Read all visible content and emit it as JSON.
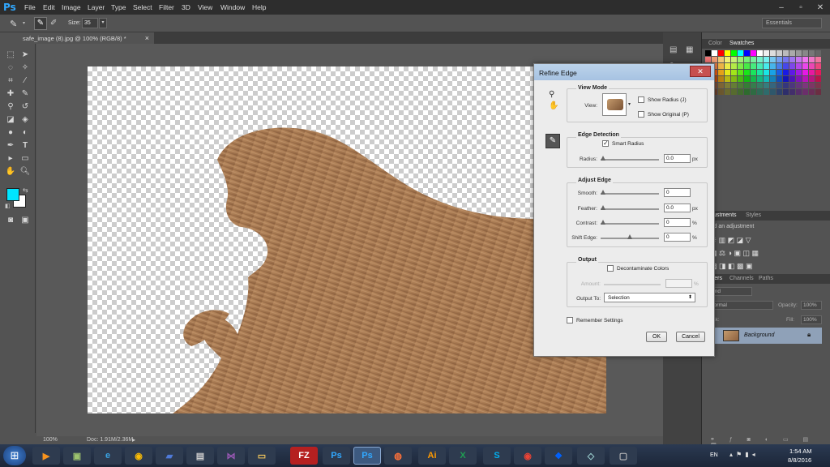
{
  "app": {
    "logo": "Ps"
  },
  "menu": [
    "File",
    "Edit",
    "Image",
    "Layer",
    "Type",
    "Select",
    "Filter",
    "3D",
    "View",
    "Window",
    "Help"
  ],
  "options": {
    "size_label": "Size:",
    "size_value": "35",
    "workspace": "Essentials"
  },
  "document": {
    "tab_title": "safe_image (8).jpg @ 100% (RGB/8) *",
    "close": "×"
  },
  "status": {
    "zoom": "100%",
    "doc": "Doc: 1.91M/2.36M"
  },
  "colors": {
    "foreground": "#00e5ff",
    "background": "#ffffff",
    "accent": "#31a8ff"
  },
  "dialog": {
    "title": "Refine Edge",
    "view_mode": {
      "title": "View Mode",
      "view_label": "View:",
      "show_radius": "Show Radius (J)",
      "show_original": "Show Original (P)"
    },
    "edge_detection": {
      "title": "Edge Detection",
      "smart_radius": "Smart Radius",
      "smart_radius_checked": true,
      "radius_label": "Radius:",
      "radius_value": "0.0",
      "radius_unit": "px"
    },
    "adjust_edge": {
      "title": "Adjust Edge",
      "smooth_label": "Smooth:",
      "smooth_value": "0",
      "feather_label": "Feather:",
      "feather_value": "0.0",
      "feather_unit": "px",
      "contrast_label": "Contrast:",
      "contrast_value": "0",
      "contrast_unit": "%",
      "shift_label": "Shift Edge:",
      "shift_value": "0",
      "shift_unit": "%"
    },
    "output": {
      "title": "Output",
      "decontaminate": "Decontaminate Colors",
      "amount_label": "Amount:",
      "amount_unit": "%",
      "output_to_label": "Output To:",
      "output_to_value": "Selection"
    },
    "remember": "Remember Settings",
    "ok": "OK",
    "cancel": "Cancel"
  },
  "panels": {
    "color_tabs": [
      "Color",
      "Swatches"
    ],
    "adjust_tabs": [
      "Adjustments",
      "Styles"
    ],
    "adjust_hint": "Add an adjustment",
    "layers_tabs": [
      "Layers",
      "Channels",
      "Paths"
    ],
    "layers_kind": "Kind",
    "blend_mode": "Normal",
    "opacity_label": "Opacity:",
    "opacity_value": "100%",
    "lock_label": "Lock:",
    "fill_label": "Fill:",
    "fill_value": "100%",
    "layer_name": "Background"
  },
  "taskbar": {
    "lang": "EN",
    "time": "1:54 AM",
    "date": "8/8/2016"
  }
}
